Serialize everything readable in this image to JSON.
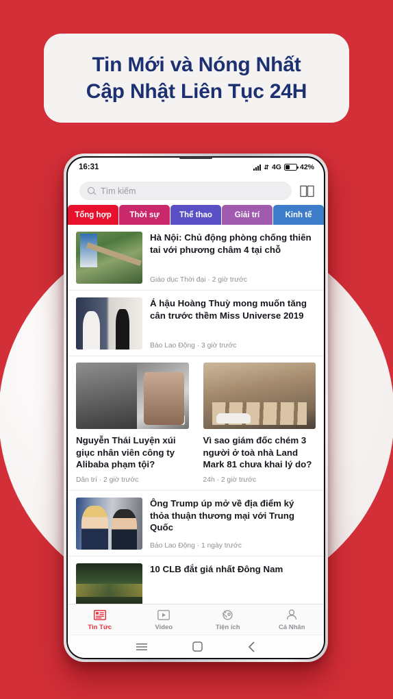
{
  "promo": {
    "line1": "Tin Mới và Nóng Nhất",
    "line2": "Cập Nhật Liên Tục 24H",
    "text_color": "#1d3172",
    "background": "#d32f38"
  },
  "phone": {
    "statusbar": {
      "time": "16:31",
      "network": "4G",
      "battery_percent": "42%",
      "signal_icon": "signal-bars-icon",
      "data_arrows_icon": "data-transfer-icon",
      "battery_icon": "battery-icon"
    },
    "search": {
      "placeholder": "Tìm kiếm",
      "value": "",
      "icon": "search-icon",
      "book_icon": "open-book-icon"
    },
    "tabs": [
      {
        "label": "Tổng hợp",
        "color": "#e8112d",
        "active": true
      },
      {
        "label": "Thời sự",
        "color": "#c9286b",
        "active": false
      },
      {
        "label": "Thể thao",
        "color": "#5a4fc4",
        "active": false
      },
      {
        "label": "Giải trí",
        "color": "#a05bae",
        "active": false
      },
      {
        "label": "Kinh tế",
        "color": "#3d7cc9",
        "active": false
      }
    ],
    "articles": [
      {
        "title": "Hà Nội: Chủ động phòng chống thiên tai với phương châm 4 tại chỗ",
        "source": "Giáo dục Thời đại",
        "time": "2 giờ trước",
        "meta": "Giáo dục Thời đại · 2 giờ trước",
        "thumb": "storm-fallen-tree-photo"
      },
      {
        "title": "Á hậu Hoàng Thuỳ mong muốn tăng cân trước thềm Miss Universe 2019",
        "source": "Báo Lao Động",
        "time": "3 giờ trước",
        "meta": "Báo Lao Động · 3 giờ trước",
        "thumb": "hoang-thuy-portrait-photo"
      }
    ],
    "grid_articles": [
      {
        "title": "Nguyễn Thái Luyện xúi giục nhân viên công ty Alibaba phạm tội?",
        "source": "Dân trí",
        "time": "2 giờ trước",
        "meta": "Dân trí · 2 giờ trước",
        "comments": "1",
        "thumb": "nguyen-thai-luyen-photo"
      },
      {
        "title": "Vì sao giám đốc chém 3 người ở toà nhà Land Mark 81 chưa khai lý do?",
        "source": "24h",
        "time": "2 giờ trước",
        "meta": "24h · 2 giờ trước",
        "comments": "",
        "thumb": "police-scene-photo"
      }
    ],
    "articles_2": [
      {
        "title": "Ông Trump úp mở về địa điểm ký thỏa thuận thương mại với Trung Quốc",
        "source": "Báo Lao Động",
        "time": "1 ngày trước",
        "meta": "Báo Lao Động · 1 ngày trước",
        "thumb": "trump-xi-photo"
      }
    ],
    "partial_article": {
      "title": "10 CLB đắt giá nhất Đông Nam",
      "thumb": "football-stadium-photo"
    },
    "bottom_nav": [
      {
        "label": "Tin Tức",
        "icon": "news-list-icon",
        "active": true
      },
      {
        "label": "Video",
        "icon": "video-play-icon",
        "active": false
      },
      {
        "label": "Tiện ích",
        "icon": "utilities-icon",
        "active": false
      },
      {
        "label": "Cá Nhân",
        "icon": "person-icon",
        "active": false
      }
    ],
    "android_nav": [
      {
        "name": "recents-button",
        "icon": "hamburger-icon"
      },
      {
        "name": "home-button",
        "icon": "square-icon"
      },
      {
        "name": "back-button",
        "icon": "chevron-left-icon"
      }
    ],
    "active_nav_color": "#e8323c"
  }
}
